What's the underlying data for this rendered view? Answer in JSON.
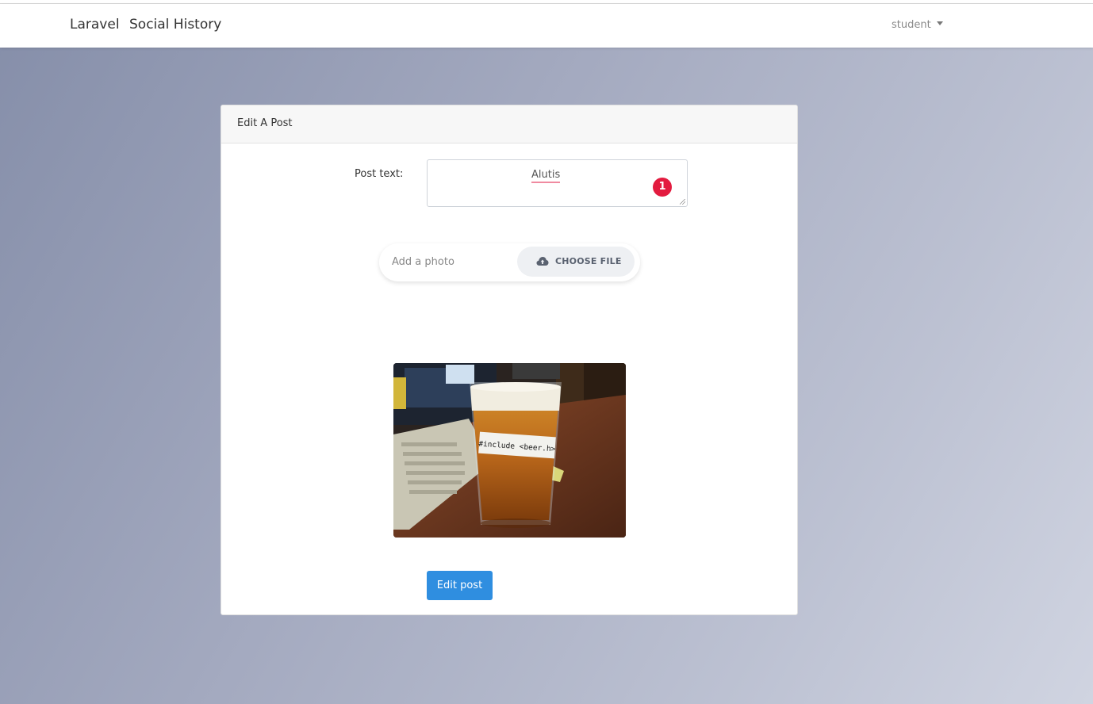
{
  "navbar": {
    "brand": "Laravel",
    "link": "Social History",
    "user": "student"
  },
  "card": {
    "title": "Edit A Post",
    "post_label": "Post text:",
    "post_value": "Alutis",
    "error_count": "1",
    "file_placeholder": "Add a photo",
    "choose_file_label": "CHOOSE FILE",
    "photo_caption": "#include <beer.h>",
    "submit_label": "Edit post"
  },
  "colors": {
    "primary_button": "#2f8ee0",
    "error_badge": "#e31b3f",
    "spell_underline": "#f08aa0"
  },
  "icons": {
    "choose_file": "cloud-upload-icon",
    "user_dropdown": "caret-down-icon"
  }
}
